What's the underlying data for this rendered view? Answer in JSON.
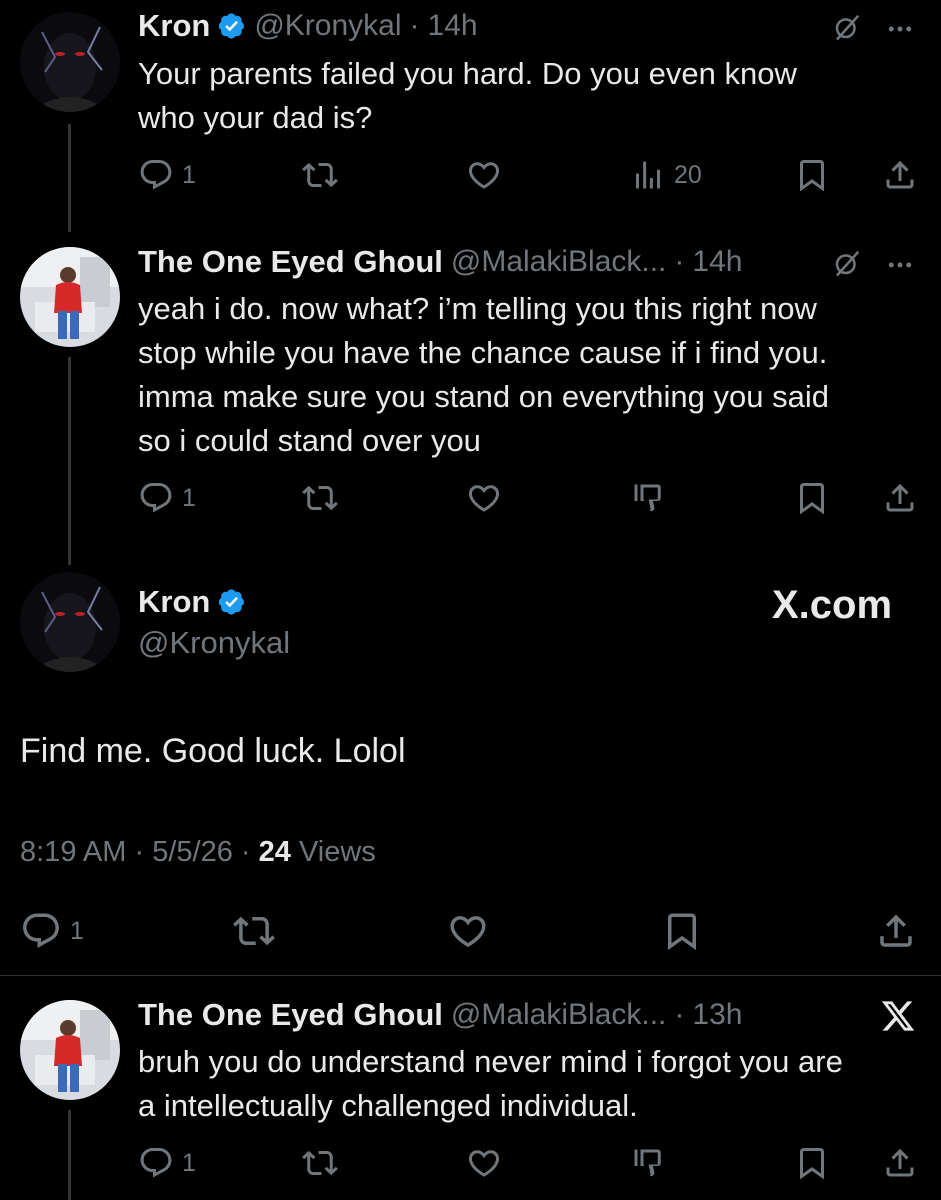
{
  "tweet1": {
    "name": "Kron",
    "handle": "@Kronykal",
    "time": "14h",
    "text_line1": "Your parents failed you hard. Do you even know",
    "text_line2": "who your dad is?",
    "reply_count": "1",
    "views_count": "20"
  },
  "tweet2": {
    "name": "The One Eyed Ghoul",
    "handle": "@MalakiBlack...",
    "time": "14h",
    "text_line1": "yeah i do. now what? i’m telling you this right now",
    "text_line2": "stop while you have the chance cause if i find you.",
    "text_line3": "imma make sure you stand on everything you said",
    "text_line4": "so i could stand over you",
    "reply_count": "1"
  },
  "main_tweet": {
    "name": "Kron",
    "handle": "@Kronykal",
    "watermark": "X.com",
    "text": "Find me. Good luck. Lolol",
    "time": "8:19 AM",
    "date": "5/5/26",
    "views_count": "24",
    "views_label": "Views",
    "reply_count": "1"
  },
  "tweet4": {
    "name": "The One Eyed Ghoul",
    "handle": "@MalakiBlack...",
    "time": "13h",
    "text_line1": "bruh you do understand never mind i forgot you are",
    "text_line2": "a intellectually challenged individual.",
    "reply_count": "1"
  },
  "separator": "·",
  "colors": {
    "background": "#000000",
    "text": "#e7e9ea",
    "muted": "#71767b",
    "verified": "#1d9bf0"
  }
}
